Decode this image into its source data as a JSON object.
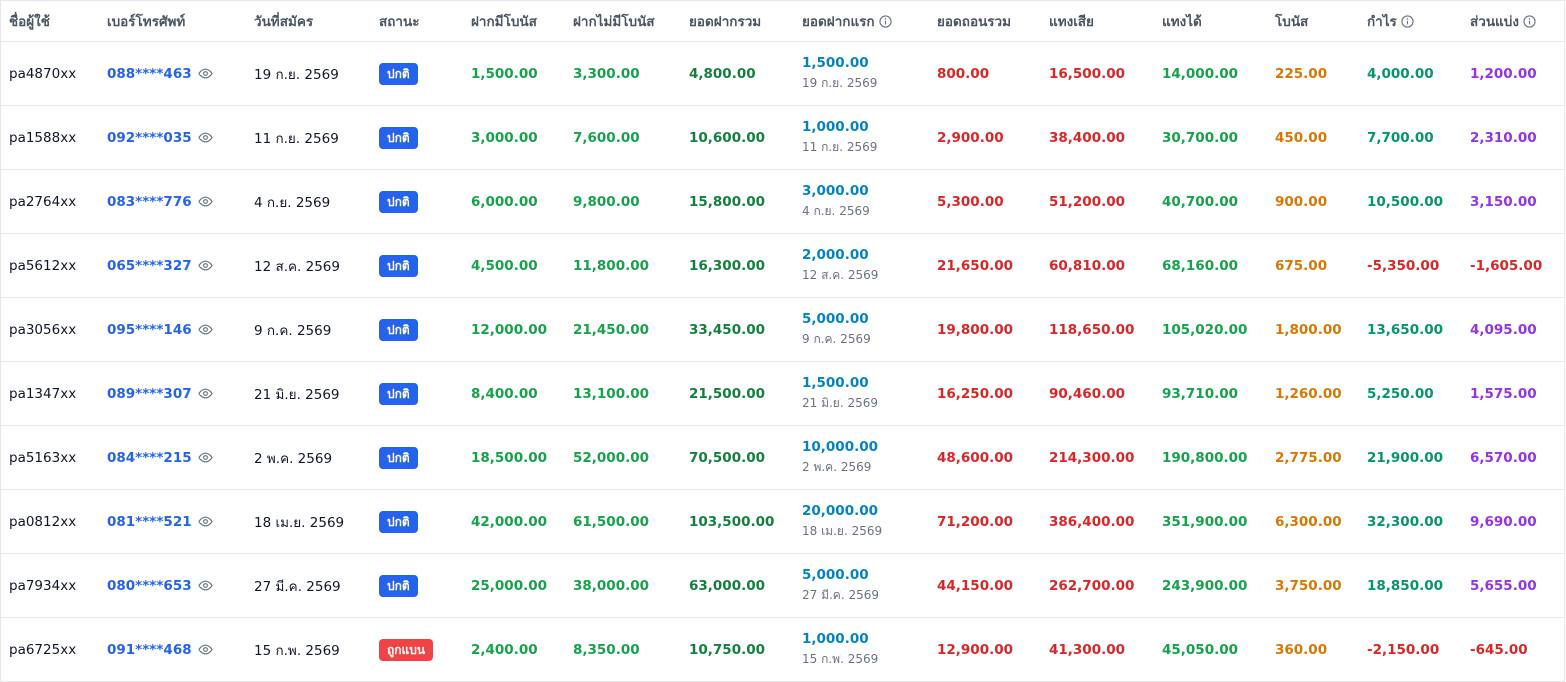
{
  "columns": {
    "username": "ชื่อผู้ใช้",
    "phone": "เบอร์โทรศัพท์",
    "register_date": "วันที่สมัคร",
    "status": "สถานะ",
    "deposit_bonus": "ฝากมีโบนัส",
    "deposit_no_bonus": "ฝากไม่มีโบนัส",
    "deposit_total": "ยอดฝากรวม",
    "first_deposit": "ยอดฝากแรก",
    "withdraw_total": "ยอดถอนรวม",
    "lose": "แทงเสีย",
    "win": "แทงได้",
    "bonus": "โบนัส",
    "profit": "กำไร",
    "share": "ส่วนแบ่ง"
  },
  "colors": {
    "phone": "#2563eb",
    "status_normal": "#2563eb",
    "status_banned": "#ef4444",
    "deposit": "#16a34a",
    "deposit_total": "#15803d",
    "first_deposit": "#0284c7",
    "negative": "#dc2626",
    "bonus": "#d97706",
    "profit": "#059669",
    "share": "#9333ea"
  },
  "rows": [
    {
      "username": "pa4870xx",
      "phone": "088****463",
      "register_date": "19 ก.ย. 2569",
      "status": "ปกติ",
      "status_type": "normal",
      "deposit_bonus": "1,500.00",
      "deposit_no_bonus": "3,300.00",
      "deposit_total": "4,800.00",
      "first_deposit_amount": "1,500.00",
      "first_deposit_date": "19 ก.ย. 2569",
      "withdraw_total": "800.00",
      "lose": "16,500.00",
      "win": "14,000.00",
      "bonus": "225.00",
      "profit": "4,000.00",
      "share": "1,200.00"
    },
    {
      "username": "pa1588xx",
      "phone": "092****035",
      "register_date": "11 ก.ย. 2569",
      "status": "ปกติ",
      "status_type": "normal",
      "deposit_bonus": "3,000.00",
      "deposit_no_bonus": "7,600.00",
      "deposit_total": "10,600.00",
      "first_deposit_amount": "1,000.00",
      "first_deposit_date": "11 ก.ย. 2569",
      "withdraw_total": "2,900.00",
      "lose": "38,400.00",
      "win": "30,700.00",
      "bonus": "450.00",
      "profit": "7,700.00",
      "share": "2,310.00"
    },
    {
      "username": "pa2764xx",
      "phone": "083****776",
      "register_date": "4 ก.ย. 2569",
      "status": "ปกติ",
      "status_type": "normal",
      "deposit_bonus": "6,000.00",
      "deposit_no_bonus": "9,800.00",
      "deposit_total": "15,800.00",
      "first_deposit_amount": "3,000.00",
      "first_deposit_date": "4 ก.ย. 2569",
      "withdraw_total": "5,300.00",
      "lose": "51,200.00",
      "win": "40,700.00",
      "bonus": "900.00",
      "profit": "10,500.00",
      "share": "3,150.00"
    },
    {
      "username": "pa5612xx",
      "phone": "065****327",
      "register_date": "12 ส.ค. 2569",
      "status": "ปกติ",
      "status_type": "normal",
      "deposit_bonus": "4,500.00",
      "deposit_no_bonus": "11,800.00",
      "deposit_total": "16,300.00",
      "first_deposit_amount": "2,000.00",
      "first_deposit_date": "12 ส.ค. 2569",
      "withdraw_total": "21,650.00",
      "lose": "60,810.00",
      "win": "68,160.00",
      "bonus": "675.00",
      "profit": "-5,350.00",
      "share": "-1,605.00"
    },
    {
      "username": "pa3056xx",
      "phone": "095****146",
      "register_date": "9 ก.ค. 2569",
      "status": "ปกติ",
      "status_type": "normal",
      "deposit_bonus": "12,000.00",
      "deposit_no_bonus": "21,450.00",
      "deposit_total": "33,450.00",
      "first_deposit_amount": "5,000.00",
      "first_deposit_date": "9 ก.ค. 2569",
      "withdraw_total": "19,800.00",
      "lose": "118,650.00",
      "win": "105,020.00",
      "bonus": "1,800.00",
      "profit": "13,650.00",
      "share": "4,095.00"
    },
    {
      "username": "pa1347xx",
      "phone": "089****307",
      "register_date": "21 มิ.ย. 2569",
      "status": "ปกติ",
      "status_type": "normal",
      "deposit_bonus": "8,400.00",
      "deposit_no_bonus": "13,100.00",
      "deposit_total": "21,500.00",
      "first_deposit_amount": "1,500.00",
      "first_deposit_date": "21 มิ.ย. 2569",
      "withdraw_total": "16,250.00",
      "lose": "90,460.00",
      "win": "93,710.00",
      "bonus": "1,260.00",
      "profit": "5,250.00",
      "share": "1,575.00"
    },
    {
      "username": "pa5163xx",
      "phone": "084****215",
      "register_date": "2 พ.ค. 2569",
      "status": "ปกติ",
      "status_type": "normal",
      "deposit_bonus": "18,500.00",
      "deposit_no_bonus": "52,000.00",
      "deposit_total": "70,500.00",
      "first_deposit_amount": "10,000.00",
      "first_deposit_date": "2 พ.ค. 2569",
      "withdraw_total": "48,600.00",
      "lose": "214,300.00",
      "win": "190,800.00",
      "bonus": "2,775.00",
      "profit": "21,900.00",
      "share": "6,570.00"
    },
    {
      "username": "pa0812xx",
      "phone": "081****521",
      "register_date": "18 เม.ย. 2569",
      "status": "ปกติ",
      "status_type": "normal",
      "deposit_bonus": "42,000.00",
      "deposit_no_bonus": "61,500.00",
      "deposit_total": "103,500.00",
      "first_deposit_amount": "20,000.00",
      "first_deposit_date": "18 เม.ย. 2569",
      "withdraw_total": "71,200.00",
      "lose": "386,400.00",
      "win": "351,900.00",
      "bonus": "6,300.00",
      "profit": "32,300.00",
      "share": "9,690.00"
    },
    {
      "username": "pa7934xx",
      "phone": "080****653",
      "register_date": "27 มี.ค. 2569",
      "status": "ปกติ",
      "status_type": "normal",
      "deposit_bonus": "25,000.00",
      "deposit_no_bonus": "38,000.00",
      "deposit_total": "63,000.00",
      "first_deposit_amount": "5,000.00",
      "first_deposit_date": "27 มี.ค. 2569",
      "withdraw_total": "44,150.00",
      "lose": "262,700.00",
      "win": "243,900.00",
      "bonus": "3,750.00",
      "profit": "18,850.00",
      "share": "5,655.00"
    },
    {
      "username": "pa6725xx",
      "phone": "091****468",
      "register_date": "15 ก.พ. 2569",
      "status": "ถูกแบน",
      "status_type": "banned",
      "deposit_bonus": "2,400.00",
      "deposit_no_bonus": "8,350.00",
      "deposit_total": "10,750.00",
      "first_deposit_amount": "1,000.00",
      "first_deposit_date": "15 ก.พ. 2569",
      "withdraw_total": "12,900.00",
      "lose": "41,300.00",
      "win": "45,050.00",
      "bonus": "360.00",
      "profit": "-2,150.00",
      "share": "-645.00"
    }
  ]
}
